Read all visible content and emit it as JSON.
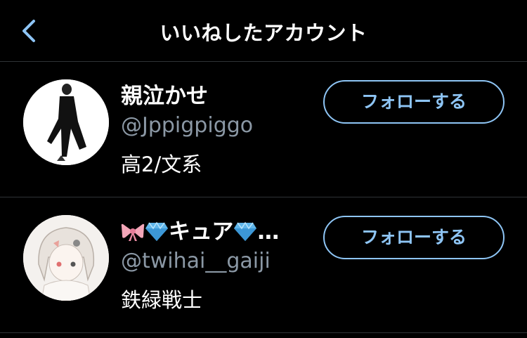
{
  "header": {
    "title": "いいねしたアカウント"
  },
  "users": [
    {
      "name": "親泣かせ",
      "handle": "@Jppigpiggo",
      "bio": "高2/文系",
      "follow_label": "フォローする"
    },
    {
      "name_text": "キュア",
      "name_ellipsis": "…",
      "handle": "@twihai__gaiji",
      "bio": "鉄緑戦士",
      "follow_label": "フォローする"
    }
  ],
  "colors": {
    "background": "#000000",
    "accent": "#8ec5f5",
    "secondary_text": "#8b98a5",
    "divider": "#2f3336"
  },
  "icons": [
    "back-chevron-icon",
    "ribbon-emoji",
    "gem-emoji"
  ]
}
